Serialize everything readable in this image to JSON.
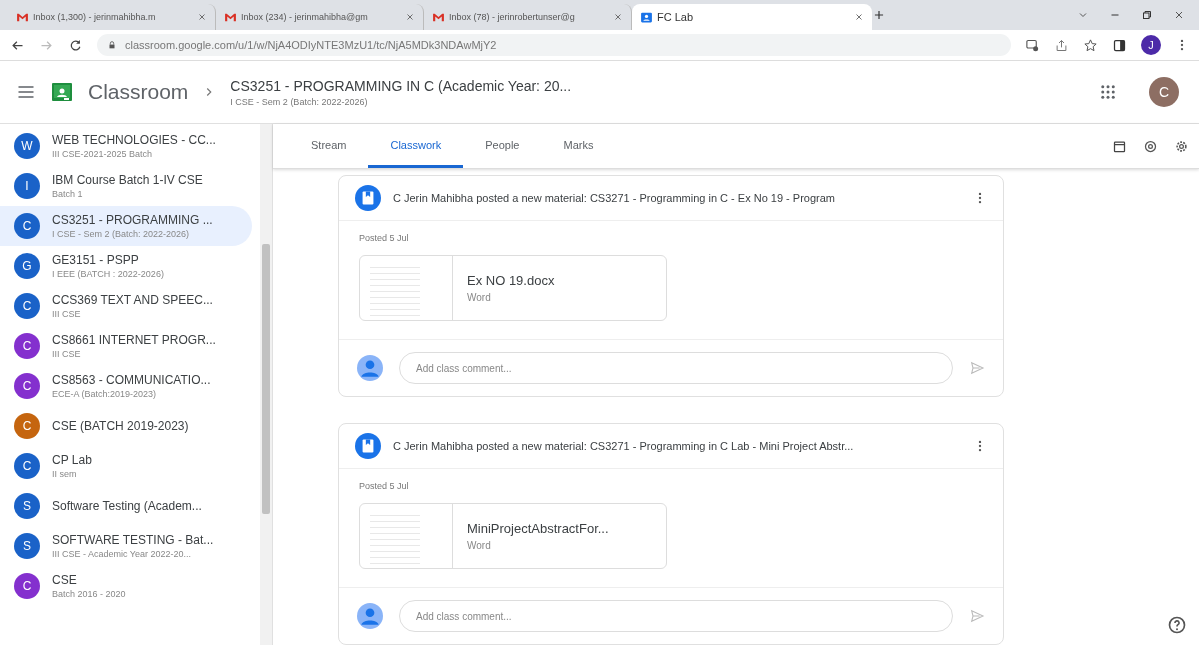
{
  "browser": {
    "tabs": [
      {
        "kind": "mail",
        "title": "Inbox (1,300) - jerinmahibha.m",
        "selected": false
      },
      {
        "kind": "mail",
        "title": "Inbox (234) - jerinmahibha@gm",
        "selected": false
      },
      {
        "kind": "mail",
        "title": "Inbox (78) - jerinrobertunser@g",
        "selected": false
      },
      {
        "kind": "classroom",
        "title": "FC Lab",
        "selected": true
      }
    ],
    "url": "classroom.google.com/u/1/w/NjA4ODIyNTE3MzU1/tc/NjA5MDk3NDAwMjY2",
    "profile_initial": "J"
  },
  "header": {
    "app_name": "Classroom",
    "class_title": "CS3251 - PROGRAMMING IN C (Academic Year: 20...",
    "class_subtitle": "I CSE - Sem 2 (Batch: 2022-2026)",
    "account_initial": "C"
  },
  "sidebar": {
    "items": [
      {
        "letter": "W",
        "title": "WEB TECHNOLOGIES - CC...",
        "subtitle": "III CSE-2021-2025 Batch",
        "color": "#1a62c8",
        "selected": false
      },
      {
        "letter": "I",
        "title": "IBM Course Batch 1-IV CSE",
        "subtitle": "Batch 1",
        "color": "#1a62c8",
        "selected": false
      },
      {
        "letter": "C",
        "title": "CS3251 - PROGRAMMING ...",
        "subtitle": "I CSE - Sem 2 (Batch: 2022-2026)",
        "color": "#1a62c8",
        "selected": true
      },
      {
        "letter": "G",
        "title": "GE3151 - PSPP",
        "subtitle": "I EEE (BATCH : 2022-2026)",
        "color": "#1a62c8",
        "selected": false
      },
      {
        "letter": "C",
        "title": "CCS369 TEXT AND SPEEC...",
        "subtitle": "III CSE",
        "color": "#1a62c8",
        "selected": false
      },
      {
        "letter": "C",
        "title": "CS8661 INTERNET PROGR...",
        "subtitle": "III CSE",
        "color": "#8430ce",
        "selected": false
      },
      {
        "letter": "C",
        "title": "CS8563 - COMMUNICATIO...",
        "subtitle": "ECE-A (Batch:2019-2023)",
        "color": "#8430ce",
        "selected": false
      },
      {
        "letter": "C",
        "title": "CSE (BATCH 2019-2023)",
        "color": "#c5650f",
        "selected": false
      },
      {
        "letter": "C",
        "title": "CP Lab",
        "subtitle": "II sem",
        "color": "#1a62c8",
        "selected": false
      },
      {
        "letter": "S",
        "title": "Software Testing (Academ...",
        "color": "#1a62c8",
        "selected": false
      },
      {
        "letter": "S",
        "title": "SOFTWARE TESTING - Bat...",
        "subtitle": "III CSE - Academic Year 2022-20...",
        "color": "#1a62c8",
        "selected": false
      },
      {
        "letter": "C",
        "title": "CSE",
        "subtitle": "Batch 2016 - 2020",
        "color": "#8430ce",
        "selected": false
      }
    ]
  },
  "nav_tabs": [
    {
      "label": "Stream",
      "selected": false
    },
    {
      "label": "Classwork",
      "selected": true
    },
    {
      "label": "People",
      "selected": false
    },
    {
      "label": "Marks",
      "selected": false
    }
  ],
  "posts": [
    {
      "title": "C Jerin Mahibha posted a new material: CS3271 - Programming in C - Ex No 19 - Program",
      "posted": "Posted 5 Jul",
      "attachment": {
        "name": "Ex NO 19.docx",
        "type": "Word"
      },
      "comment_placeholder": "Add class comment..."
    },
    {
      "title": "C Jerin Mahibha posted a new material: CS3271 - Programming in C Lab - Mini Project Abstr...",
      "posted": "Posted 5 Jul",
      "attachment": {
        "name": "MiniProjectAbstractFor...",
        "type": "Word"
      },
      "comment_placeholder": "Add class comment..."
    }
  ]
}
